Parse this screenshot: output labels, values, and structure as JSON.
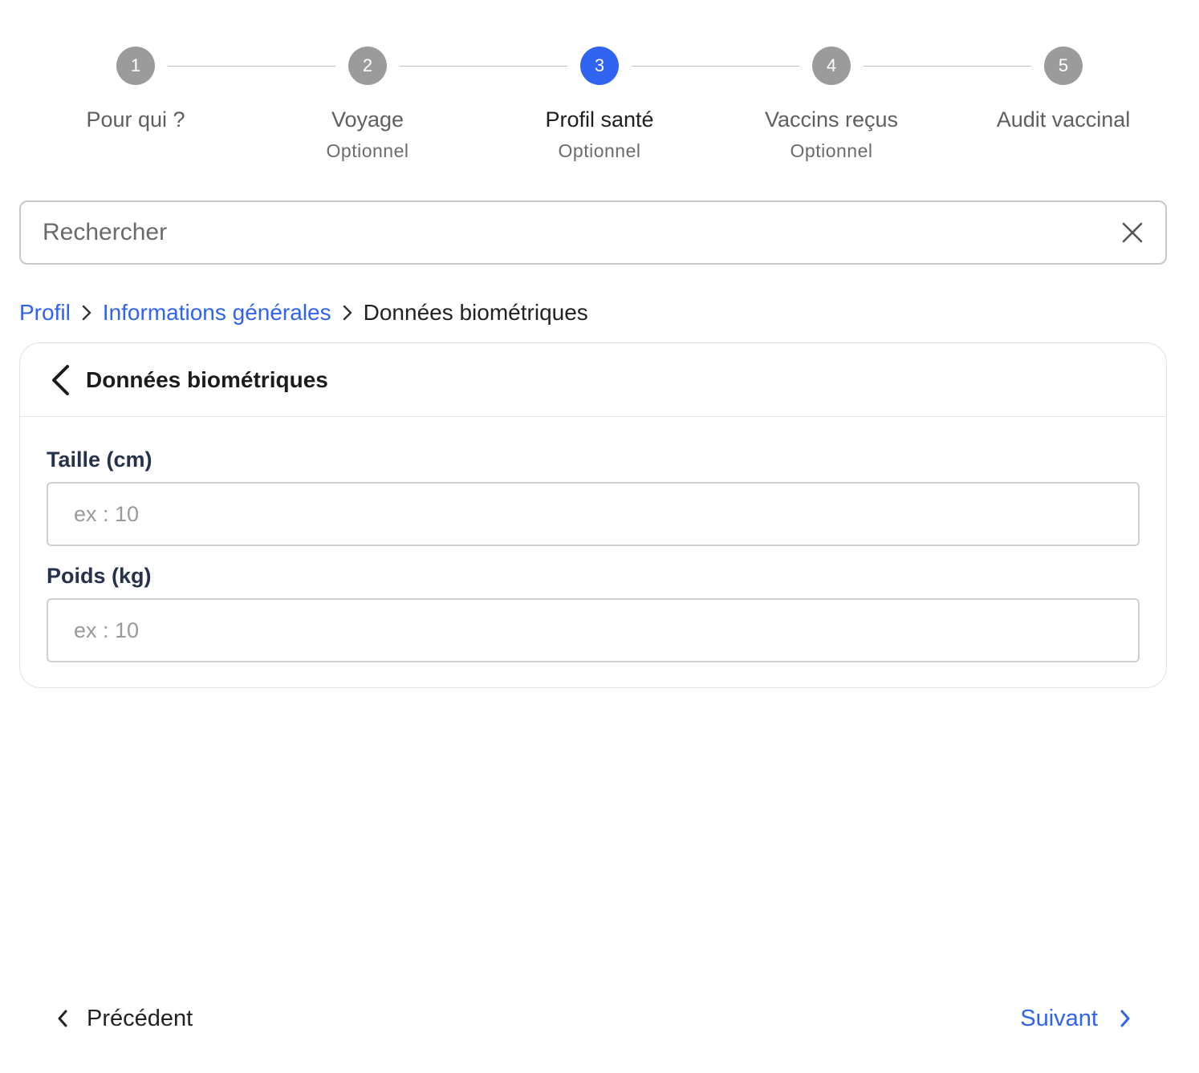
{
  "stepper": {
    "steps": [
      {
        "number": "1",
        "label": "Pour qui ?",
        "sub": ""
      },
      {
        "number": "2",
        "label": "Voyage",
        "sub": "Optionnel"
      },
      {
        "number": "3",
        "label": "Profil santé",
        "sub": "Optionnel"
      },
      {
        "number": "4",
        "label": "Vaccins reçus",
        "sub": "Optionnel"
      },
      {
        "number": "5",
        "label": "Audit vaccinal",
        "sub": ""
      }
    ],
    "active_step": 3
  },
  "search": {
    "placeholder": "Rechercher",
    "value": ""
  },
  "breadcrumb": {
    "items": [
      "Profil",
      "Informations générales",
      "Données biométriques"
    ]
  },
  "card": {
    "title": "Données biométriques",
    "fields": [
      {
        "label": "Taille (cm)",
        "placeholder": "ex : 10",
        "value": ""
      },
      {
        "label": "Poids (kg)",
        "placeholder": "ex : 10",
        "value": ""
      }
    ]
  },
  "footer": {
    "prev_label": "Précédent",
    "next_label": "Suivant"
  },
  "colors": {
    "accent": "#2f63f0",
    "inactive_step": "#9b9b9b"
  },
  "icons": {
    "search_clear": "close-icon",
    "card_back": "chevron-left-icon",
    "breadcrumb_separator": "chevron-right-icon",
    "prev": "chevron-left-icon",
    "next": "chevron-right-icon"
  }
}
